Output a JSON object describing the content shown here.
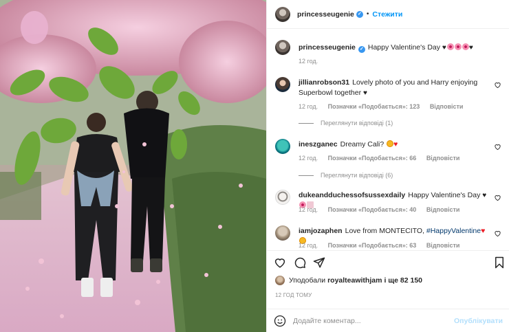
{
  "post": {
    "author": "princesseugenie",
    "follow_label": "Стежити",
    "caption": "Happy Valentine's Day",
    "caption_age": "12 год."
  },
  "comments": [
    {
      "user": "jillianrobson31",
      "text": "Lovely photo of you and Harry enjoying Superbowl together",
      "age": "12 год.",
      "likes": "Позначки «Подобається»: 123",
      "reply_label": "Відповісти",
      "view_replies": "Переглянути відповіді (1)"
    },
    {
      "user": "ineszganec",
      "text": "Dreamy Cali?",
      "age": "12 год.",
      "likes": "Позначки «Подобається»: 66",
      "reply_label": "Відповісти",
      "view_replies": "Переглянути відповіді (6)"
    },
    {
      "user": "dukeandduchessofsussexdaily",
      "text": "Happy Valentine's Day",
      "age": "12 год.",
      "likes": "Позначки «Подобається»: 40",
      "reply_label": "Відповісти"
    },
    {
      "user": "iamjozaphen",
      "text": "Love from MONTECITO,",
      "hashtag": "#HappyValentine",
      "age": "12 год.",
      "likes": "Позначки «Подобається»: 63",
      "reply_label": "Відповісти"
    }
  ],
  "likes_summary": {
    "prefix": "Уподобали",
    "user": "royalteawithjam",
    "suffix": "і ще 82 150"
  },
  "timestamp": "12 ГОД ТОМУ",
  "composer": {
    "placeholder": "Додайте коментар...",
    "publish_label": "Опублікувати"
  },
  "icons": {
    "like": "heart-icon",
    "comment": "comment-icon",
    "share": "share-icon",
    "save": "bookmark-icon",
    "emoji": "emoji-icon",
    "verified": "verified-badge-icon"
  },
  "colors": {
    "accent": "#0095f6",
    "verified": "#3897f0",
    "muted": "#8e8e8e",
    "publish_disabled": "#b2dffc"
  }
}
